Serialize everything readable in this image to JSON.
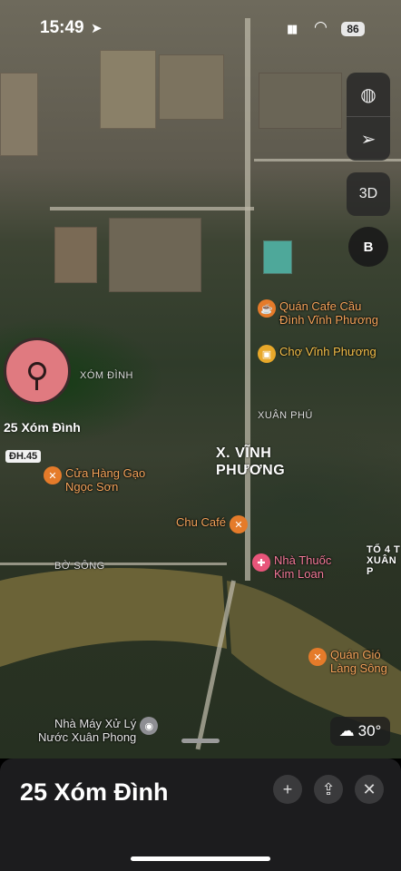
{
  "status_bar": {
    "time": "15:49",
    "battery": "86"
  },
  "map_controls": {
    "view_mode_label": "3D",
    "compass_label": "B"
  },
  "pois": [
    {
      "label": "Quán Cafe Cầu\nĐình Vĩnh Phương",
      "icon": "cafe-icon",
      "color": "#e57b2a"
    },
    {
      "label": "Chợ Vĩnh Phương",
      "icon": "shopping-bag-icon",
      "color": "#e8a82a"
    },
    {
      "label": "Cửa Hàng Gạo\nNgọc Sơn",
      "icon": "food-icon",
      "color": "#e57b2a"
    },
    {
      "label": "Chu Café",
      "icon": "food-icon",
      "color": "#e57b2a"
    },
    {
      "label": "Nhà Thuốc\nKim Loan",
      "icon": "pharmacy-icon",
      "color": "#e8557a"
    },
    {
      "label": "Quán Gió\nLàng Sông",
      "icon": "food-icon",
      "color": "#e57b2a"
    },
    {
      "label": "Nhà Máy Xử Lý\nNước Xuân Phong",
      "icon": "facility-icon",
      "color": "#8e8e93"
    }
  ],
  "area_labels": {
    "ward": "X. VĨNH\nPHƯƠNG",
    "xom_dinh": "XÓM ĐÌNH",
    "xuan_phu": "XUÂN PHÚ",
    "bo_song": "BỜ SÔNG",
    "to_4": "TỔ 4 T\nXUÂN P",
    "road_badge": "ĐH.45"
  },
  "pin_label": "25 Xóm Đình",
  "weather": {
    "temperature": "30°"
  },
  "place_card": {
    "title": "25 Xóm Đình"
  }
}
